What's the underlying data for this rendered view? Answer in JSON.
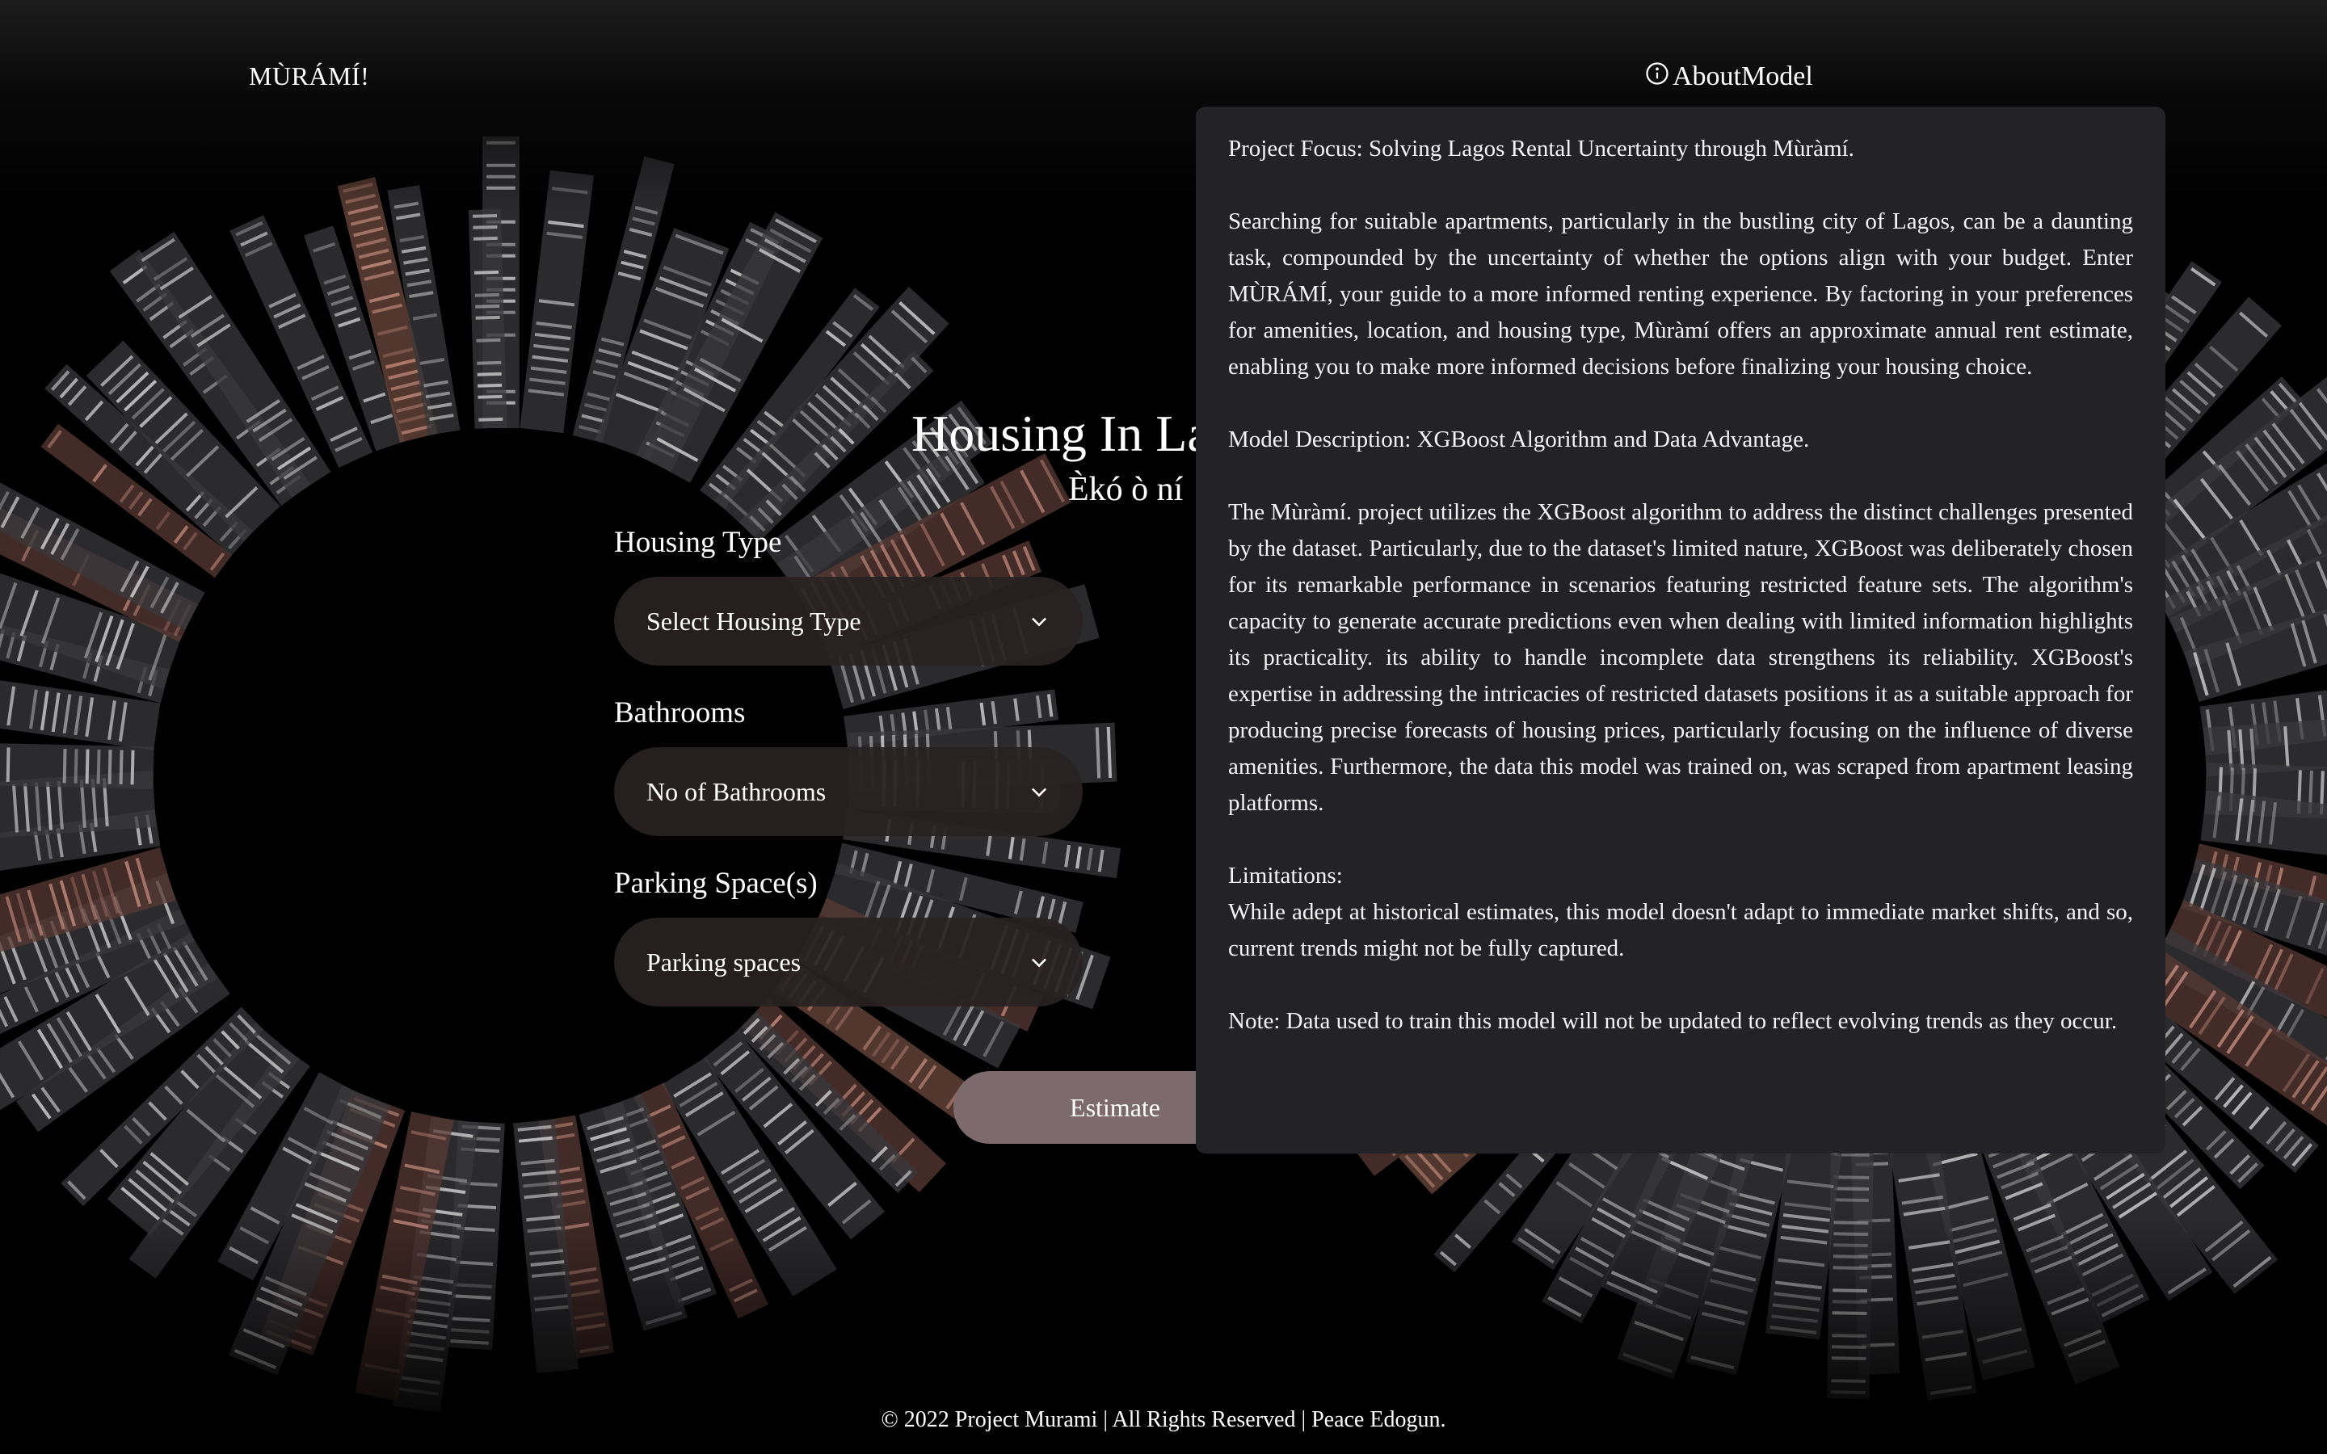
{
  "header": {
    "brand": "MÙRÁMÍ!",
    "about_label": "AboutModel"
  },
  "hero": {
    "title": "Housing In Lagos",
    "subtitle": "Èkó ò ní"
  },
  "form": {
    "housing_type": {
      "label": "Housing Type",
      "value": "Select Housing Type"
    },
    "bathrooms": {
      "label": "Bathrooms",
      "value": "No of Bathrooms"
    },
    "parking": {
      "label": "Parking Space(s)",
      "value": "Parking spaces"
    },
    "estimate_label": "Estimate"
  },
  "about": {
    "focus": "Project Focus: Solving Lagos Rental Uncertainty through Mùràmí.",
    "intro": "Searching for suitable apartments, particularly in the bustling city of Lagos, can be a daunting task, compounded by the uncertainty of whether the options align with your budget. Enter MÙRÁMÍ, your guide to a more informed renting experience. By factoring in your preferences for amenities, location, and housing type, Mùràmí offers an approximate annual rent estimate, enabling you to make more informed decisions before finalizing your housing choice.",
    "model_heading": "Model Description: XGBoost Algorithm and Data Advantage.",
    "model_body": "The Mùràmí. project utilizes the XGBoost algorithm to address the distinct challenges presented by the dataset. Particularly, due to the dataset's limited nature, XGBoost was deliberately chosen for its remarkable performance in scenarios featuring restricted feature sets. The algorithm's capacity to generate accurate predictions even when dealing with limited information highlights its practicality. its ability to handle incomplete data strengthens its reliability. XGBoost's expertise in addressing the intricacies of restricted datasets positions it as a suitable approach for producing precise forecasts of housing prices, particularly focusing on the influence of diverse amenities. Furthermore, the data this model was trained on, was scraped from apartment leasing platforms.",
    "limitations_heading": "Limitations:",
    "limitations_body": "While adept at historical estimates, this model doesn't adapt to immediate market shifts, and so, current trends might not be fully captured.",
    "note": "Note: Data used to train this model will not be updated to reflect evolving trends as they occur."
  },
  "footer": {
    "text": "© 2022 Project Murami | All Rights Reserved | Peace Edogun."
  },
  "colors": {
    "panel_bg": "#232226",
    "select_bg": "#282222",
    "button_bg": "#7d6a6c",
    "background": "#000000"
  }
}
